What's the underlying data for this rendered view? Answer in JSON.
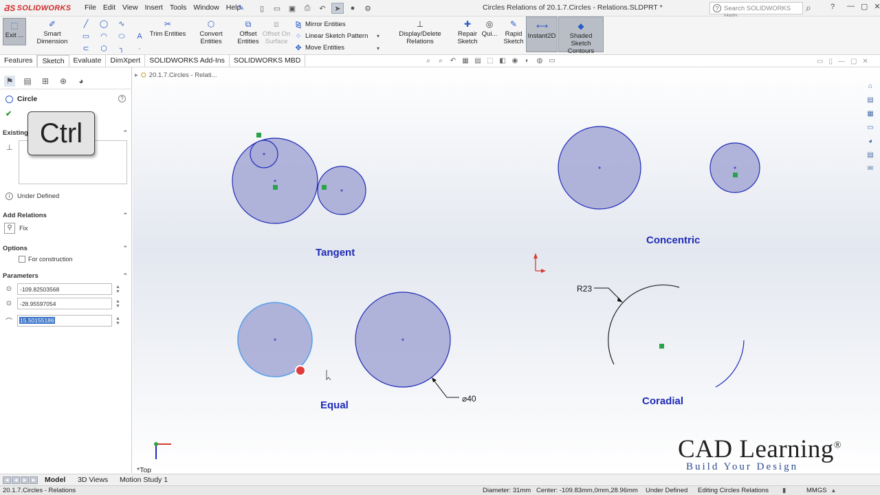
{
  "app": {
    "logo": "SOLIDWORKS",
    "menu": [
      "File",
      "Edit",
      "View",
      "Insert",
      "Tools",
      "Window",
      "Help"
    ],
    "document_title": "Circles Relations of 20.1.7.Circles - Relations.SLDPRT *",
    "help_search_placeholder": "Search SOLIDWORKS Help"
  },
  "ribbon": {
    "exit_sketch": "Exit ...",
    "smart_dimension": "Smart Dimension",
    "trim_entities": "Trim Entities",
    "convert_entities": "Convert Entities",
    "offset_entities": [
      "Offset",
      "Entities"
    ],
    "offset_on_surface": [
      "Offset On",
      "Surface"
    ],
    "mirror_entities": "Mirror Entities",
    "linear_sketch_pattern": "Linear Sketch Pattern",
    "move_entities": "Move Entities",
    "display_delete_relations": "Display/Delete Relations",
    "repair_sketch": [
      "Repair",
      "Sketch"
    ],
    "quick_snaps": "Qui...",
    "rapid_sketch": [
      "Rapid",
      "Sketch"
    ],
    "instant2d": "Instant2D",
    "shaded_sketch_contours": [
      "Shaded Sketch",
      "Contours"
    ]
  },
  "tabs": [
    "Features",
    "Sketch",
    "Evaluate",
    "DimXpert",
    "SOLIDWORKS Add-Ins",
    "SOLIDWORKS MBD"
  ],
  "active_tab": "Sketch",
  "property_manager": {
    "title": "Circle",
    "existing_relations_label": "Existing",
    "ctrl_key_overlay": "Ctrl",
    "status": "Under Defined",
    "add_relations_label": "Add Relations",
    "fix_label": "Fix",
    "options_label": "Options",
    "for_construction_label": "For construction",
    "parameters_label": "Parameters",
    "center_x": "-109.82503568",
    "center_y": "-28.95597054",
    "radius": "15.50155186"
  },
  "feature_tree_breadcrumb": "20.1.7.Circles - Relati...",
  "sketch_labels": {
    "tangent": "Tangent",
    "concentric": "Concentric",
    "equal": "Equal",
    "coradial": "Coradial",
    "radius_dim": "R23",
    "diameter_dim": "⌀40"
  },
  "orientation_label": "*Top",
  "brand": {
    "name": "CAD Learning",
    "registered": "®",
    "tagline": "Build Your Design"
  },
  "bottom_tabs": [
    "Model",
    "3D Views",
    "Motion Study 1"
  ],
  "statusbar": {
    "file": "20.1.7.Circles - Relations",
    "diameter": "Diameter: 31mm",
    "center": "Center: -109.83mm,0mm,28.96mm",
    "definition": "Under Defined",
    "mode": "Editing Circles Relations",
    "units": "MMGS"
  },
  "colors": {
    "circle_fill": "#a9acd6",
    "circle_stroke": "#1f2bb6",
    "selected_stroke": "#5aa0e8",
    "label_color": "#1f2bb6",
    "accent_red": "#d22b2b"
  }
}
